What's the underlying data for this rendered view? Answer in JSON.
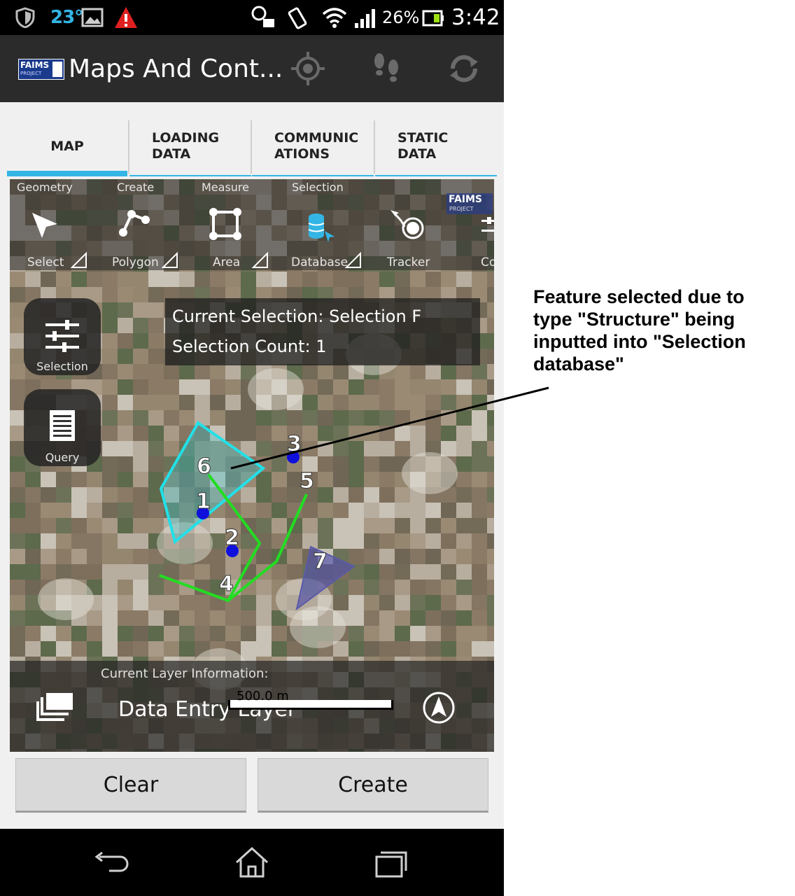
{
  "status_bar": {
    "temperature": "23°",
    "battery_percent": "26%",
    "time": "3:42",
    "icons": [
      "shield-icon",
      "image-icon",
      "warning-icon",
      "alarm-icon",
      "vibrate-icon",
      "wifi-icon",
      "signal-icon",
      "battery-icon"
    ]
  },
  "action_bar": {
    "logo_text": "FAIMS",
    "logo_sub": "PROJECT",
    "title": "Maps And Cont...",
    "icons": [
      "gps-target-icon",
      "footsteps-icon",
      "sync-icon"
    ]
  },
  "tabs": [
    {
      "label": "MAP",
      "active": true
    },
    {
      "label": "LOADING\nDATA",
      "active": false
    },
    {
      "label": "COMMUNIC\nATIONS",
      "active": false
    },
    {
      "label": "STATIC\nDATA",
      "active": false
    }
  ],
  "toolbar": {
    "groups": [
      "Geometry",
      "Create",
      "Measure",
      "Selection"
    ],
    "tools": [
      {
        "label": "Select",
        "icon": "select-arrow-icon"
      },
      {
        "label": "Polygon",
        "icon": "polygon-icon"
      },
      {
        "label": "Area",
        "icon": "area-icon"
      },
      {
        "label": "Database",
        "icon": "database-icon"
      },
      {
        "label": "Tracker",
        "icon": "tracker-icon"
      },
      {
        "label": "Co",
        "icon": "controls-icon"
      }
    ],
    "watermark": "FAIMS",
    "watermark_sub": "PROJECT"
  },
  "side_buttons": [
    {
      "label": "Selection",
      "icon": "sliders-icon"
    },
    {
      "label": "Query",
      "icon": "document-icon"
    }
  ],
  "selection_info": {
    "current_selection": "Current Selection: Selection F",
    "selection_count": "Selection Count: 1"
  },
  "map_features": {
    "labels": [
      "1",
      "2",
      "3",
      "4",
      "5",
      "6",
      "7"
    ],
    "colors": {
      "selected": "#22e0e8",
      "line": "#22dd22",
      "point": "#1010dd",
      "triangle": "#5a5aa8"
    }
  },
  "layer_panel": {
    "current_layer_label": "Current Layer Information:",
    "layer_name": "Data Entry Layer",
    "scale_label": "500.0 m"
  },
  "buttons": {
    "clear": "Clear",
    "create": "Create"
  },
  "nav_bar": {
    "icons": [
      "back-icon",
      "home-icon",
      "recents-icon"
    ]
  },
  "annotation": {
    "text": "Feature selected due to type \"Structure\" being inputted into \"Selection database\""
  }
}
